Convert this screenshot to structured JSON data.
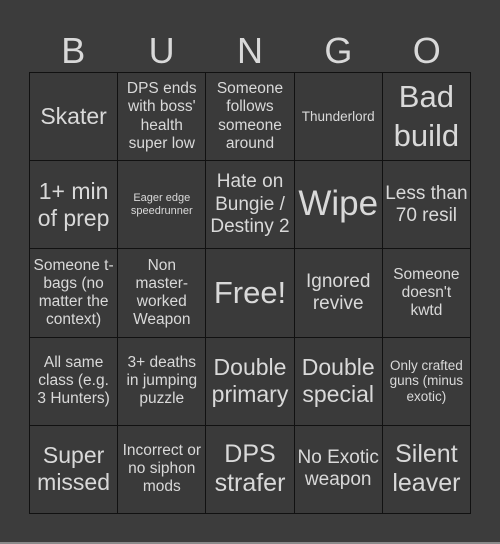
{
  "header": {
    "letters": [
      "B",
      "U",
      "N",
      "G",
      "O"
    ]
  },
  "board": {
    "rows": [
      [
        "Skater",
        "DPS ends with boss' health super low",
        "Someone follows someone around",
        "Thunderlord",
        "Bad build"
      ],
      [
        "1+ min of prep",
        "Eager edge speedrunner",
        "Hate on Bungie / Destiny 2",
        "Wipe",
        "Less than 70 resil"
      ],
      [
        "Someone t-bags (no matter the context)",
        "Non master-worked Weapon",
        "Free!",
        "Ignored revive",
        "Someone doesn't kwtd"
      ],
      [
        "All same class (e.g. 3 Hunters)",
        "3+ deaths in jumping puzzle",
        "Double primary",
        "Double special",
        "Only crafted guns (minus exotic)"
      ],
      [
        "Super missed",
        "Incorrect or no siphon mods",
        "DPS strafer",
        "No Exotic weapon",
        "Silent leaver"
      ]
    ]
  },
  "colors": {
    "background": "#3c3c3c",
    "cell": "#3a3a3a",
    "border": "#111111",
    "text": "#d9d9d9"
  }
}
